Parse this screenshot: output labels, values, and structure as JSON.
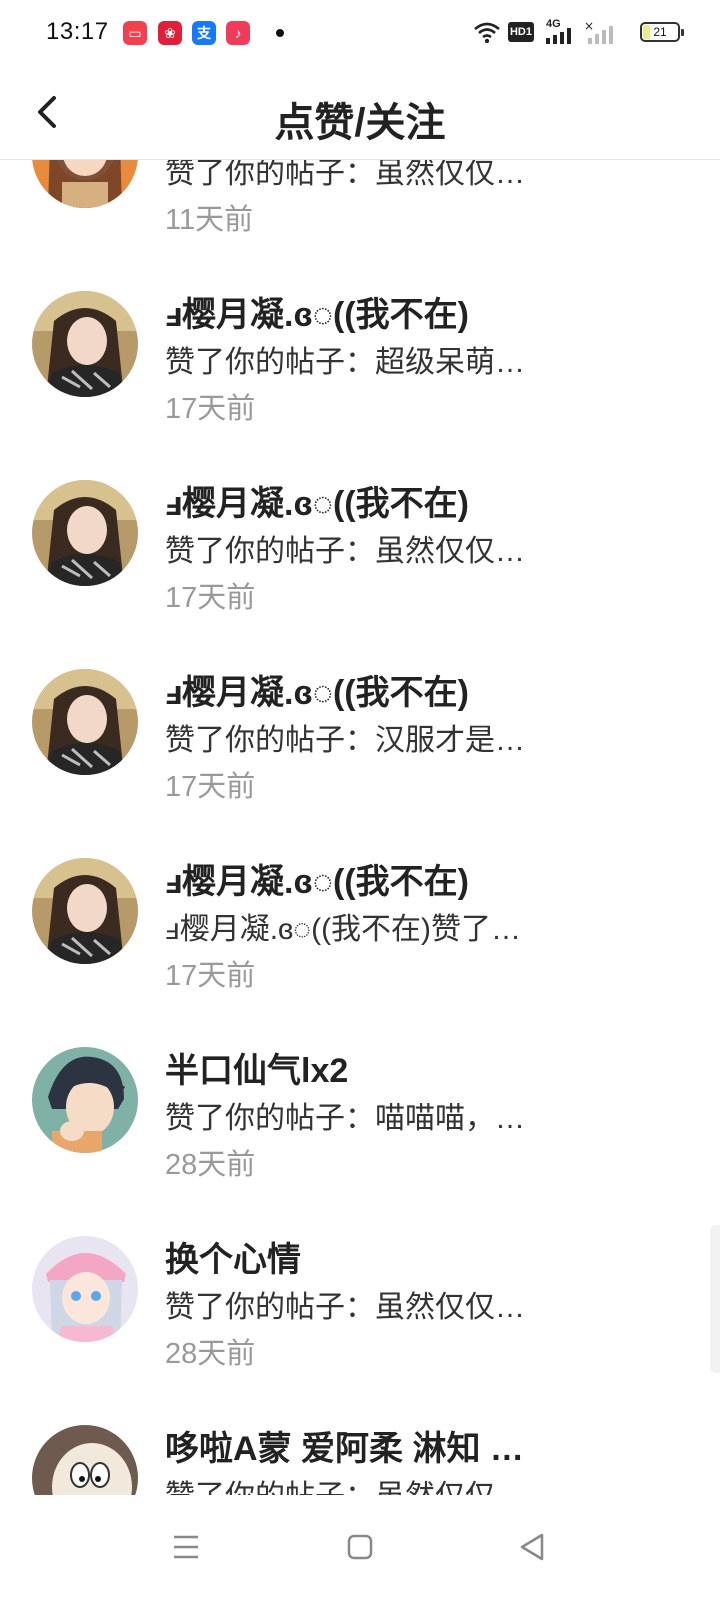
{
  "status_bar": {
    "time": "13:17",
    "battery": "21",
    "icons": [
      "video-app-icon",
      "red-app-icon",
      "alipay-icon",
      "music-icon",
      "wifi-icon",
      "hd-icon",
      "4g-signal-icon",
      "no-signal-icon",
      "battery-icon"
    ],
    "hd_label": "HD1",
    "network_label": "4G"
  },
  "header": {
    "title": "点赞/关注"
  },
  "notifications": [
    {
      "name": "",
      "desc": "赞了你的帖子：虽然仅仅…",
      "time": "11天前",
      "avatar": "girl-autumn"
    },
    {
      "name": "ⅎ樱月凝.ɞ◌((我不在)",
      "desc": "赞了你的帖子：超级呆萌…",
      "time": "17天前",
      "avatar": "girl-scarf"
    },
    {
      "name": "ⅎ樱月凝.ɞ◌((我不在)",
      "desc": "赞了你的帖子：虽然仅仅…",
      "time": "17天前",
      "avatar": "girl-scarf"
    },
    {
      "name": "ⅎ樱月凝.ɞ◌((我不在)",
      "desc": "赞了你的帖子：汉服才是…",
      "time": "17天前",
      "avatar": "girl-scarf"
    },
    {
      "name": "ⅎ樱月凝.ɞ◌((我不在)",
      "desc": "ⅎ樱月凝.ɞ◌((我不在)赞了…",
      "time": "17天前",
      "avatar": "girl-scarf"
    },
    {
      "name": "半口仙气lx2",
      "desc": "赞了你的帖子：喵喵喵，…",
      "time": "28天前",
      "avatar": "anime-boy"
    },
    {
      "name": "换个心情",
      "desc": "赞了你的帖子：虽然仅仅…",
      "time": "28天前",
      "avatar": "anime-girl"
    },
    {
      "name": "哆啦A蒙 爱阿柔 淋知 …",
      "desc": "赞了你的帖子：虽然仅仅…",
      "time": "",
      "avatar": "doraemon"
    }
  ],
  "colors": {
    "accent_name": "#222222",
    "time_gray": "#999999",
    "divider": "#e6e6e6"
  }
}
